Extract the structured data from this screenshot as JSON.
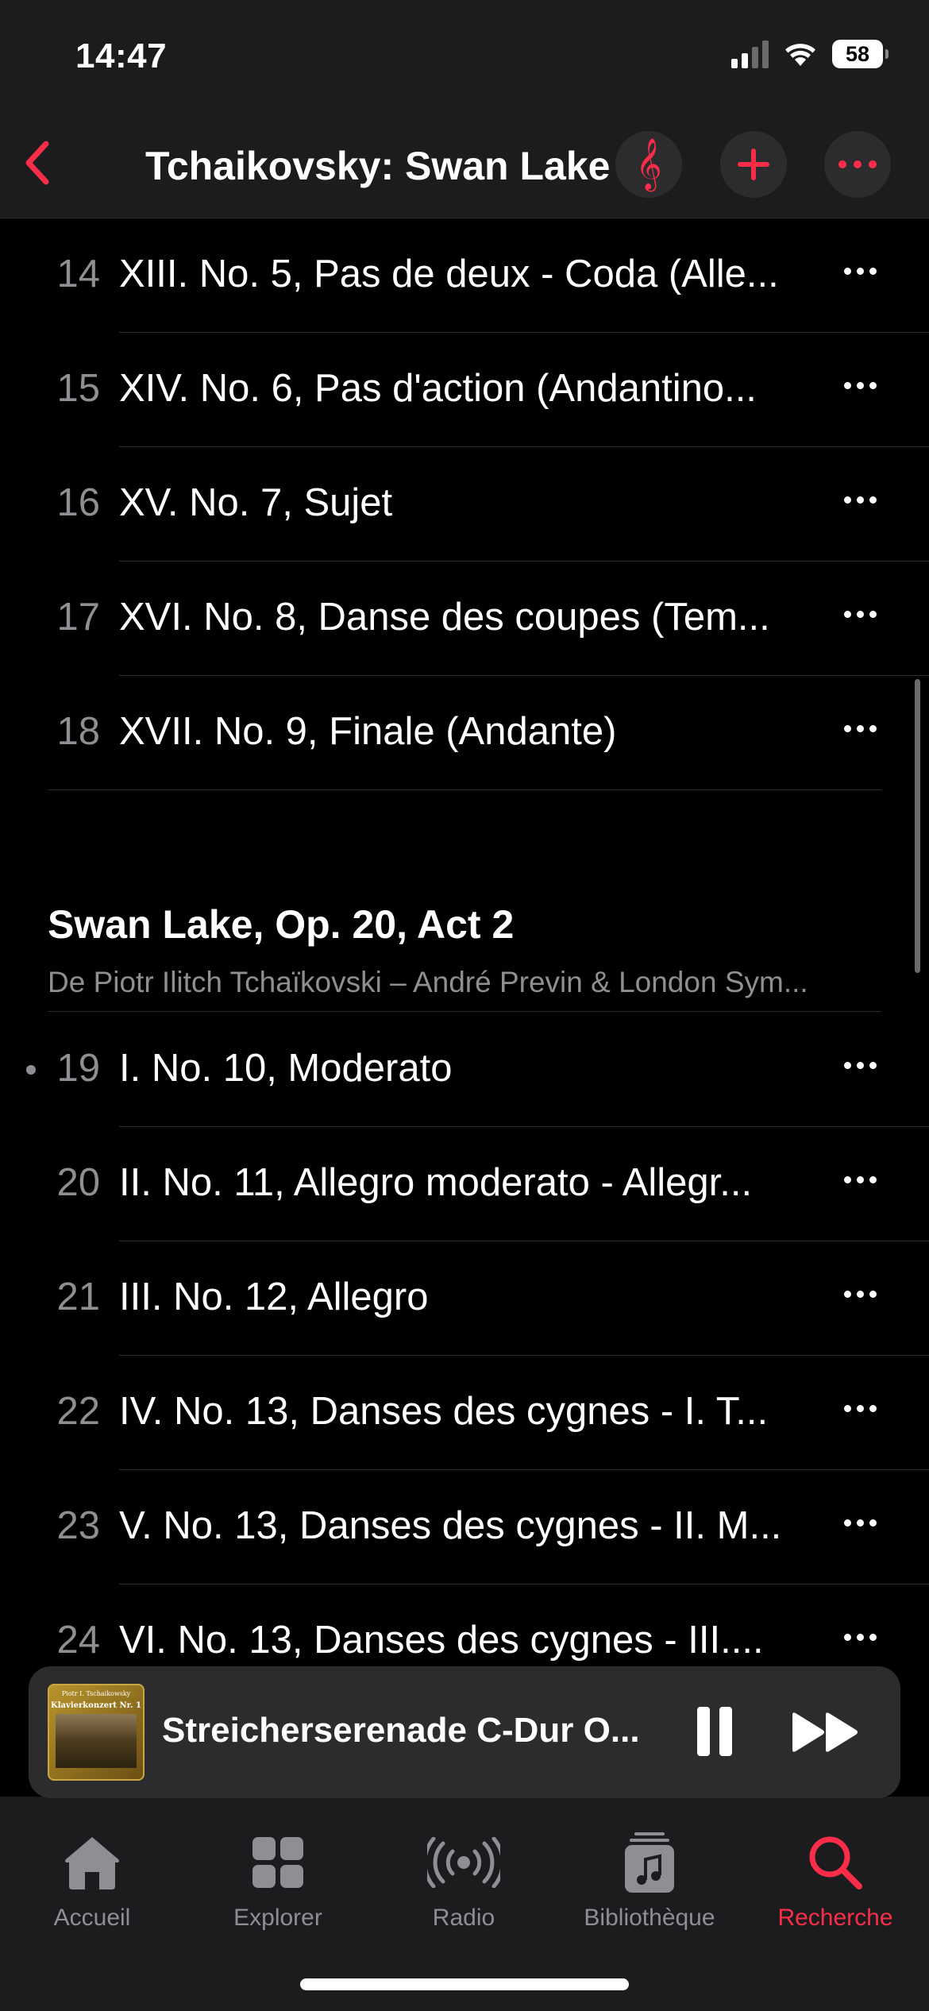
{
  "status_bar": {
    "time": "14:47",
    "battery": "58"
  },
  "header": {
    "title": "Tchaikovsky: Swan Lake"
  },
  "tracks_before": [
    {
      "number": "14",
      "title": "XIII. No. 5, Pas de deux - Coda (Alle..."
    },
    {
      "number": "15",
      "title": "XIV. No. 6, Pas d'action (Andantino..."
    },
    {
      "number": "16",
      "title": "XV. No. 7, Sujet"
    },
    {
      "number": "17",
      "title": "XVI. No. 8, Danse des coupes (Tem..."
    },
    {
      "number": "18",
      "title": "XVII. No. 9, Finale (Andante)"
    }
  ],
  "section": {
    "title": "Swan Lake, Op. 20, Act 2",
    "subtitle": "De Piotr Ilitch Tchaïkovski – André Previn & London Sym..."
  },
  "tracks_after": [
    {
      "number": "19",
      "title": "I. No. 10, Moderato"
    },
    {
      "number": "20",
      "title": "II. No. 11, Allegro moderato - Allegr..."
    },
    {
      "number": "21",
      "title": "III. No. 12, Allegro"
    },
    {
      "number": "22",
      "title": "IV. No. 13, Danses des cygnes - I. T..."
    },
    {
      "number": "23",
      "title": "V. No. 13, Danses des cygnes - II. M..."
    },
    {
      "number": "24",
      "title": "VI. No. 13, Danses des cygnes - III...."
    }
  ],
  "mini_player": {
    "title": "Streicherserenade C-Dur O...",
    "artwork_text_1": "Piotr I. Tschaikowsky",
    "artwork_text_2": "Klavierkonzert Nr. 1"
  },
  "tab_bar": {
    "tabs": [
      {
        "label": "Accueil",
        "icon": "home-icon"
      },
      {
        "label": "Explorer",
        "icon": "grid-icon"
      },
      {
        "label": "Radio",
        "icon": "radio-icon"
      },
      {
        "label": "Bibliothèque",
        "icon": "library-icon"
      },
      {
        "label": "Recherche",
        "icon": "search-icon"
      }
    ],
    "active_index": 4
  },
  "colors": {
    "accent": "#fa2d48",
    "background": "#000000",
    "secondary_text": "#8e8e93"
  }
}
